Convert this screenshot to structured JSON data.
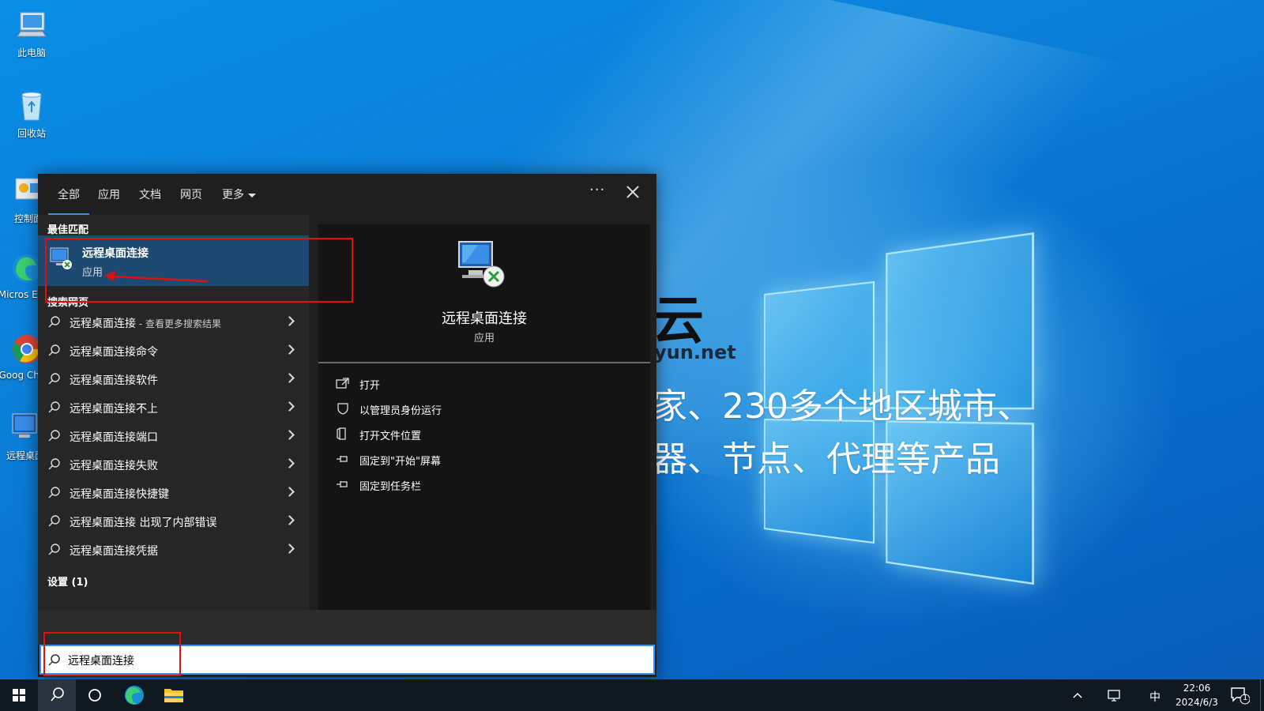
{
  "desktop": {
    "icons": [
      {
        "label": "此电脑",
        "icon": "computer-icon"
      },
      {
        "label": "回收站",
        "icon": "recycle-bin-icon"
      },
      {
        "label": "控制面",
        "icon": "control-panel-icon"
      },
      {
        "label": "Micros Edge",
        "icon": "edge-icon"
      },
      {
        "label": "Goog Chron",
        "icon": "chrome-icon"
      },
      {
        "label": "远程桌面",
        "icon": "remote-desktop-icon"
      }
    ],
    "watermark": {
      "title": "云",
      "domain": "yun.net",
      "line1": "家、230多个地区城市、",
      "line2": "器、节点、代理等产品"
    }
  },
  "search_panel": {
    "tabs": [
      {
        "label": "全部",
        "active": true
      },
      {
        "label": "应用",
        "active": false
      },
      {
        "label": "文档",
        "active": false
      },
      {
        "label": "网页",
        "active": false
      },
      {
        "label": "更多",
        "active": false
      }
    ],
    "more_options_label": "···",
    "best_match_header": "最佳匹配",
    "best_match": {
      "title": "远程桌面连接",
      "subtitle": "应用",
      "icon": "remote-desktop-icon"
    },
    "web_header": "搜索网页",
    "web_results": [
      {
        "main": "远程桌面连接",
        "suffix": " - 查看更多搜索结果"
      },
      {
        "main": "远程桌面连接命令",
        "suffix": ""
      },
      {
        "main": "远程桌面连接软件",
        "suffix": ""
      },
      {
        "main": "远程桌面连接不上",
        "suffix": ""
      },
      {
        "main": "远程桌面连接端口",
        "suffix": ""
      },
      {
        "main": "远程桌面连接失败",
        "suffix": ""
      },
      {
        "main": "远程桌面连接快捷键",
        "suffix": ""
      },
      {
        "main": "远程桌面连接 出现了内部错误",
        "suffix": ""
      },
      {
        "main": "远程桌面连接凭据",
        "suffix": ""
      }
    ],
    "settings_header": "设置 (1)",
    "preview": {
      "title": "远程桌面连接",
      "subtitle": "应用",
      "actions": [
        {
          "label": "打开",
          "icon": "open-icon"
        },
        {
          "label": "以管理员身份运行",
          "icon": "shield-icon"
        },
        {
          "label": "打开文件位置",
          "icon": "file-location-icon"
        },
        {
          "label": "固定到\"开始\"屏幕",
          "icon": "pin-icon"
        },
        {
          "label": "固定到任务栏",
          "icon": "pin-icon"
        }
      ]
    },
    "search_value": "远程桌面连接"
  },
  "taskbar": {
    "ime": "中",
    "time": "22:06",
    "date": "2024/6/3",
    "notification_count": "1"
  },
  "colors": {
    "panel_bg": "#1f1f1f",
    "selected_bg": "#1e4a72",
    "accent": "#3a8ee6",
    "annotation": "#e01010"
  }
}
